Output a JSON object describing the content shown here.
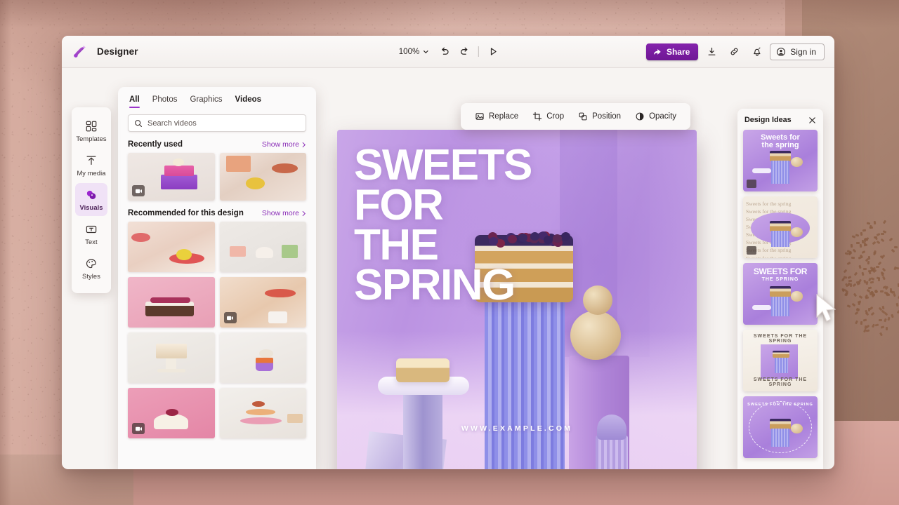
{
  "app": {
    "name": "Designer",
    "logo_icon": "designer-logo-icon"
  },
  "titlebar": {
    "zoom_level": "100%",
    "chevron_icon": "chevron-down-icon",
    "undo_icon": "undo-icon",
    "redo_icon": "redo-icon",
    "present_icon": "play-present-icon",
    "share_label": "Share",
    "share_icon": "share-icon",
    "download_icon": "download-icon",
    "link_icon": "link-icon",
    "notification_icon": "notification-bell-icon",
    "signin_label": "Sign in",
    "account_icon": "account-circle-icon",
    "share_color": "#7b1fa2"
  },
  "sidebar": {
    "items": [
      {
        "label": "Templates",
        "icon": "templates-grid-icon",
        "active": false
      },
      {
        "label": "My media",
        "icon": "upload-arrow-icon",
        "active": false
      },
      {
        "label": "Visuals",
        "icon": "visuals-shapes-icon",
        "active": true
      },
      {
        "label": "Text",
        "icon": "text-box-icon",
        "active": false
      },
      {
        "label": "Styles",
        "icon": "styles-palette-icon",
        "active": false
      }
    ],
    "active_color": "#f0e2f6",
    "accent_color": "#9b34c9"
  },
  "panel": {
    "tabs": [
      {
        "label": "All",
        "active": true
      },
      {
        "label": "Photos",
        "active": false
      },
      {
        "label": "Graphics",
        "active": false
      },
      {
        "label": "Videos",
        "active": false,
        "bold": true
      }
    ],
    "search": {
      "placeholder": "Search videos",
      "value": "",
      "icon": "search-icon"
    },
    "sections": [
      {
        "title": "Recently used",
        "show_more": "Show more",
        "chevron_icon": "chevron-right-icon",
        "items": [
          {
            "name": "layered-pink-purple-cake-video",
            "video": true
          },
          {
            "name": "lemon-on-table-still",
            "video": false
          }
        ]
      },
      {
        "title": "Recommended for this design",
        "show_more": "Show more",
        "chevron_icon": "chevron-right-icon",
        "items": [
          {
            "name": "lemon-slices-red-plate",
            "video": false
          },
          {
            "name": "pastel-desserts-trio",
            "video": false
          },
          {
            "name": "raspberry-chocolate-cake-pink",
            "video": false
          },
          {
            "name": "mug-and-pastry-scene",
            "video": true
          },
          {
            "name": "white-cake-on-stand",
            "video": false
          },
          {
            "name": "purple-cupcake",
            "video": false
          },
          {
            "name": "cherry-dome-dessert-pink",
            "video": true
          },
          {
            "name": "macaron-tower",
            "video": false
          }
        ]
      }
    ]
  },
  "float_toolbar": {
    "items": [
      {
        "label": "Replace",
        "icon": "replace-image-icon"
      },
      {
        "label": "Crop",
        "icon": "crop-icon"
      },
      {
        "label": "Position",
        "icon": "position-layers-icon"
      },
      {
        "label": "Opacity",
        "icon": "opacity-circle-icon"
      }
    ]
  },
  "canvas": {
    "title_lines": [
      "SWEETS",
      "FOR",
      "THE",
      "SPRING"
    ],
    "website": "WWW.EXAMPLE.COM",
    "bg_color": "#bb93e2",
    "text_color": "#ffffff"
  },
  "design_ideas": {
    "title": "Design Ideas",
    "close_icon": "close-x-icon",
    "cards": [
      {
        "name": "idea-card-1",
        "style": "purple-heading",
        "text": "Sweets for\nthe spring",
        "badge": true
      },
      {
        "name": "idea-card-2",
        "style": "typographic-repeat",
        "text": "Sweets for the spring",
        "badge": true
      },
      {
        "name": "idea-card-3",
        "style": "bold-caps",
        "text": "SWEETS FOR",
        "subtext": "THE SPRING",
        "badge": false
      },
      {
        "name": "idea-card-4",
        "style": "light-minimal",
        "text": "SWEETS FOR THE SPRING",
        "badge": false
      },
      {
        "name": "idea-card-5",
        "style": "circular-text",
        "text": "SWEETS FOR THE SPRING",
        "badge": false
      }
    ]
  }
}
